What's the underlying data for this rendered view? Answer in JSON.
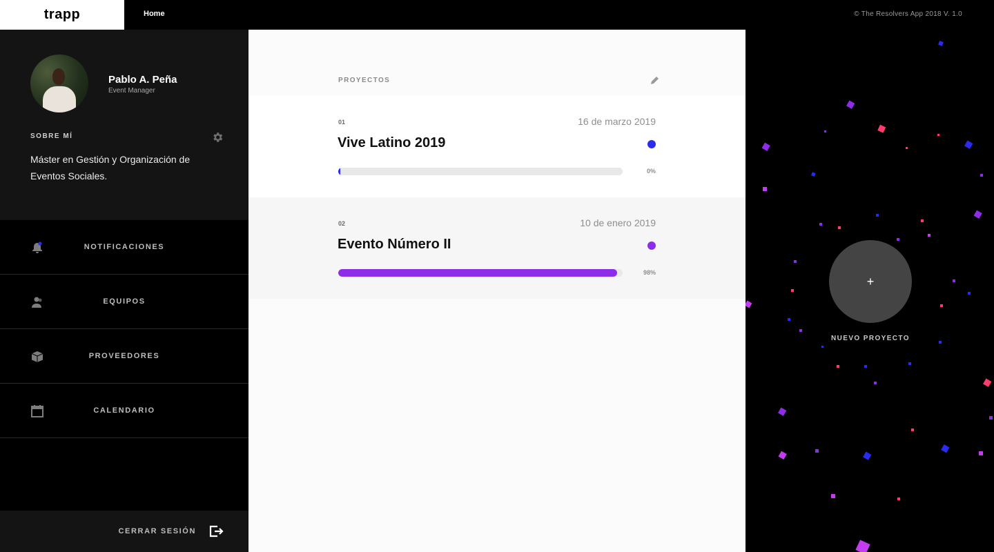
{
  "topbar": {
    "logo": "trapp",
    "home": "Home",
    "copyright": "© The Resolvers App 2018 V. 1.0"
  },
  "profile": {
    "name": "Pablo A. Peña",
    "role": "Event Manager",
    "about_label": "SOBRE MÍ",
    "about_text": "Máster en Gestión y Organización de Eventos Sociales."
  },
  "menu": [
    {
      "label": "NOTIFICACIONES",
      "icon": "bell-icon"
    },
    {
      "label": "EQUIPOS",
      "icon": "users-icon"
    },
    {
      "label": "PROVEEDORES",
      "icon": "box-icon"
    },
    {
      "label": "CALENDARIO",
      "icon": "calendar-icon"
    }
  ],
  "logout": {
    "label": "CERRAR SESIÓN",
    "icon": "logout-icon"
  },
  "projects": {
    "title": "PROYECTOS",
    "items": [
      {
        "num": "01",
        "date": "16 de marzo 2019",
        "name": "Vive Latino 2019",
        "progress": 0,
        "pct_label": "0%",
        "color": "#2b2bf0"
      },
      {
        "num": "02",
        "date": "10 de enero 2019",
        "name": "Evento Número II",
        "progress": 98,
        "pct_label": "98%",
        "color": "#8e2de8"
      }
    ]
  },
  "new_project": {
    "icon": "+",
    "label": "NUEVO PROYECTO"
  },
  "colors": {
    "accent_blue": "#2b2bf0",
    "accent_purple": "#8e2de8",
    "confetti_pink": "#ff3b6b",
    "confetti_magenta": "#c43cf0"
  }
}
